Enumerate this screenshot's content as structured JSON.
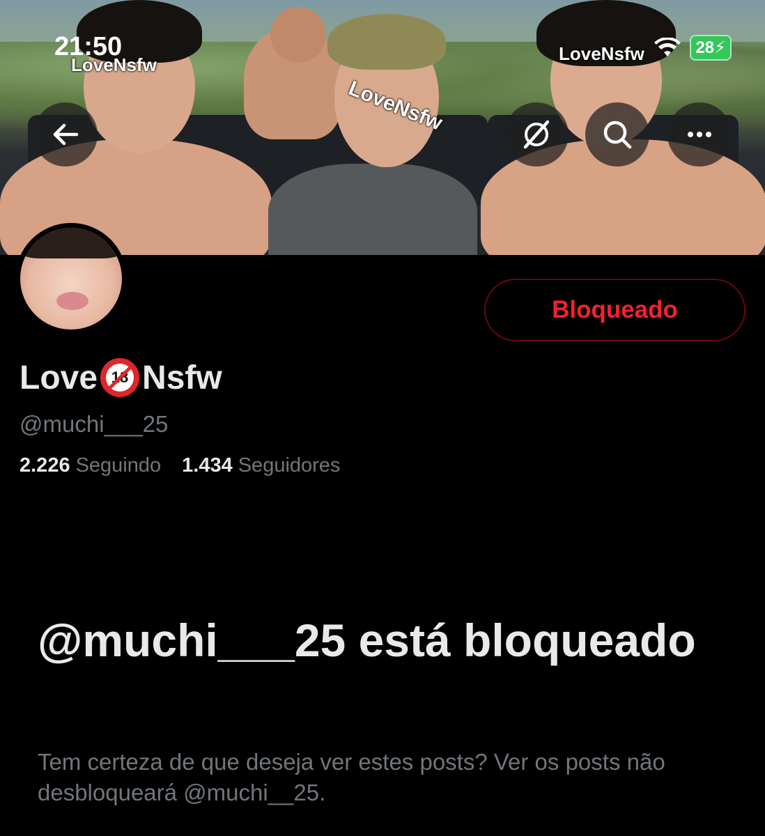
{
  "status_bar": {
    "time": "21:50",
    "battery": "28",
    "watermark_time": "LoveNsfw",
    "watermark_right": "LoveNsfw"
  },
  "banner": {
    "watermark_center": "LoveNsfw"
  },
  "top_nav": {
    "back_icon": "arrow-left-icon",
    "grok_icon": "grok-icon",
    "search_icon": "search-icon",
    "more_icon": "more-icon"
  },
  "profile": {
    "display_name_prefix": "Love",
    "display_name_emoji": "18",
    "display_name_suffix": "Nsfw",
    "handle": "@muchi___25",
    "following_count": "2.226",
    "following_label": "Seguindo",
    "followers_count": "1.434",
    "followers_label": "Seguidores",
    "blocked_button": "Bloqueado"
  },
  "blocked_notice": {
    "title": "@muchi___25 está bloqueado",
    "body": "Tem certeza de que deseja ver estes posts? Ver os posts não desbloqueará @muchi__25."
  },
  "colors": {
    "background": "#000000",
    "blocked_red": "#f4212e",
    "muted_text": "#71767b",
    "primary_text": "#e7e9ea"
  }
}
